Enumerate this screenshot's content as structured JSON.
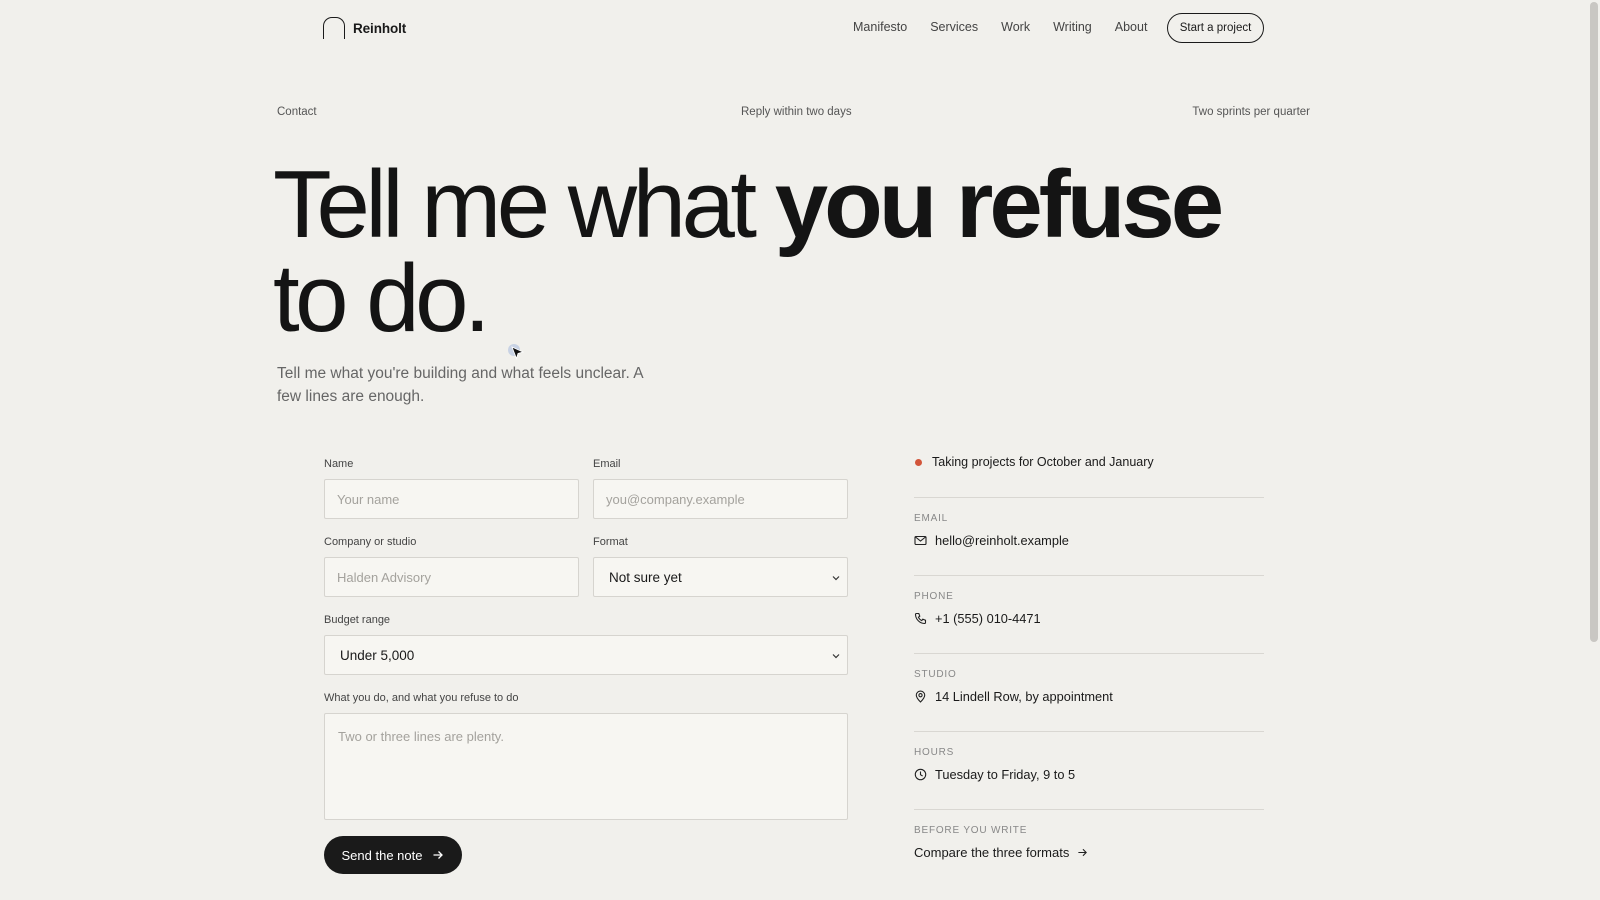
{
  "header": {
    "brand": "Reinholt",
    "nav": [
      "Manifesto",
      "Services",
      "Work",
      "Writing",
      "About"
    ],
    "cta_label": "Start a project"
  },
  "meta": {
    "left": "Contact",
    "center": "Reply within two days",
    "right": "Two sprints per quarter"
  },
  "hero": {
    "headline_start": "Tell me what ",
    "headline_bold": "you refuse",
    "headline_end": " to do.",
    "lede": "Tell me what you're building and what feels unclear. A few lines are enough."
  },
  "form": {
    "name_label": "Name",
    "name_placeholder": "Your name",
    "email_label": "Email",
    "email_placeholder": "you@company.example",
    "company_label": "Company or studio",
    "company_placeholder": "Halden Advisory",
    "format_label": "Format",
    "format_value": "Not sure yet",
    "budget_label": "Budget range",
    "budget_value": "Under 5,000",
    "message_label": "What you do, and what you refuse to do",
    "message_placeholder": "Two or three lines are plenty.",
    "submit_label": "Send the note"
  },
  "sidebar": {
    "status": "Taking projects for October and January",
    "status_color": "#d2553a",
    "email_label": "EMAIL",
    "email_value": "hello@reinholt.example",
    "phone_label": "PHONE",
    "phone_value": "+1 (555) 010-4471",
    "studio_label": "STUDIO",
    "studio_value": "14 Lindell Row, by appointment",
    "hours_label": "HOURS",
    "hours_value": "Tuesday to Friday, 9 to 5",
    "before_label": "BEFORE YOU WRITE",
    "before_link": "Compare the three formats"
  },
  "icons": {
    "email": "mail-icon",
    "phone": "phone-icon",
    "studio": "map-pin-icon",
    "hours": "clock-icon",
    "link": "arrow-right-icon"
  }
}
